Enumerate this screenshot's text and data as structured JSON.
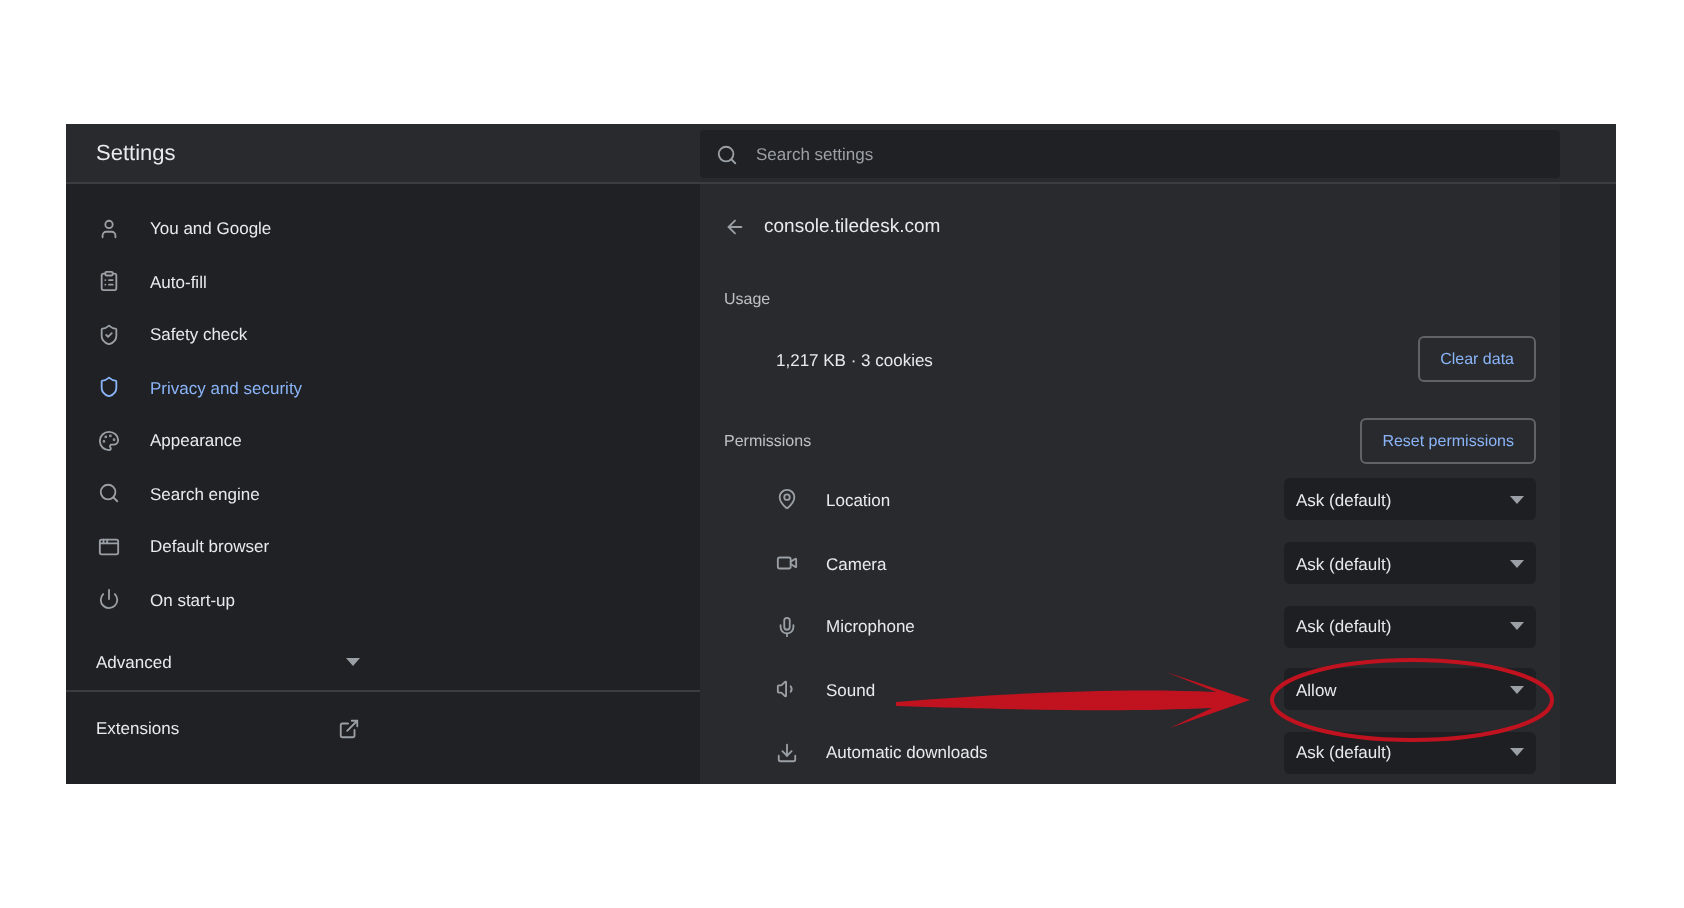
{
  "window": {
    "title": "Settings"
  },
  "search": {
    "placeholder": "Search settings"
  },
  "sidebar": {
    "items": [
      {
        "label": "You and Google",
        "selected": false
      },
      {
        "label": "Auto-fill",
        "selected": false
      },
      {
        "label": "Safety check",
        "selected": false
      },
      {
        "label": "Privacy and security",
        "selected": true
      },
      {
        "label": "Appearance",
        "selected": false
      },
      {
        "label": "Search engine",
        "selected": false
      },
      {
        "label": "Default browser",
        "selected": false
      },
      {
        "label": "On start-up",
        "selected": false
      }
    ],
    "advanced": {
      "label": "Advanced",
      "expanded": false
    },
    "extensions": {
      "label": "Extensions"
    }
  },
  "site": {
    "title": "console.tiledesk.com",
    "usage": {
      "heading": "Usage",
      "summary": "1,217 KB · 3 cookies",
      "button": "Clear data"
    },
    "permissions": {
      "heading": "Permissions",
      "button": "Reset permissions",
      "rows": [
        {
          "label": "Location",
          "value": "Ask (default)"
        },
        {
          "label": "Camera",
          "value": "Ask (default)"
        },
        {
          "label": "Microphone",
          "value": "Ask (default)"
        },
        {
          "label": "Sound",
          "value": "Allow"
        },
        {
          "label": "Automatic downloads",
          "value": "Ask (default)"
        }
      ]
    }
  }
}
